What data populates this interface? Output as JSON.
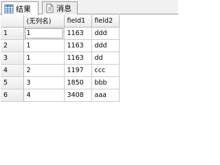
{
  "tabs": {
    "results_label": "结果",
    "messages_label": "消息"
  },
  "grid": {
    "columns": [
      "",
      "(无列名)",
      "field1",
      "field2"
    ],
    "rows": [
      {
        "num": "1",
        "c1": "1",
        "c2": "1163",
        "c3": "ddd"
      },
      {
        "num": "2",
        "c1": "1",
        "c2": "1163",
        "c3": "ddd"
      },
      {
        "num": "3",
        "c1": "1",
        "c2": "1163",
        "c3": "dd"
      },
      {
        "num": "4",
        "c1": "2",
        "c2": "1197",
        "c3": "ccc"
      },
      {
        "num": "5",
        "c1": "3",
        "c2": "1850",
        "c3": "bbb"
      },
      {
        "num": "6",
        "c1": "4",
        "c2": "3408",
        "c3": "aaa"
      }
    ]
  },
  "icons": {
    "results": "grid-icon",
    "messages": "document-icon"
  }
}
